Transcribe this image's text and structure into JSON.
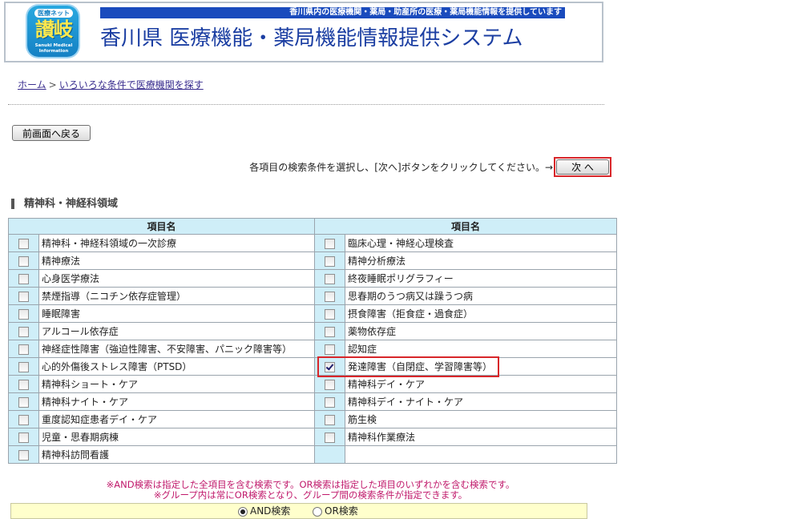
{
  "header": {
    "logo_pill": "医療ネット",
    "logo_name": "讃岐",
    "logo_sub": "Sanuki Medical Information",
    "tagline": "香川県内の医療機関・薬局・助産所の医療・薬局機能情報を提供しています",
    "site_title": "香川県 医療機能・薬局機能情報提供システム"
  },
  "breadcrumb": {
    "home": "ホーム",
    "separator": ">",
    "current": "いろいろな条件で医療機関を探す"
  },
  "buttons": {
    "back": "前画面へ戻る",
    "next": "次 へ"
  },
  "instruction": "各項目の検索条件を選択し、[次へ]ボタンをクリックしてください。→",
  "section": {
    "title": "精神科・神経科領域"
  },
  "table": {
    "header_left": "項目名",
    "header_right": "項目名",
    "left_items": [
      {
        "label": "精神科・神経科領域の一次診療",
        "checked": false
      },
      {
        "label": "精神療法",
        "checked": false
      },
      {
        "label": "心身医学療法",
        "checked": false
      },
      {
        "label": "禁煙指導（ニコチン依存症管理）",
        "checked": false
      },
      {
        "label": "睡眠障害",
        "checked": false
      },
      {
        "label": "アルコール依存症",
        "checked": false
      },
      {
        "label": "神経症性障害（強迫性障害、不安障害、パニック障害等）",
        "checked": false
      },
      {
        "label": "心的外傷後ストレス障害（PTSD）",
        "checked": false
      },
      {
        "label": "精神科ショート・ケア",
        "checked": false
      },
      {
        "label": "精神科ナイト・ケア",
        "checked": false
      },
      {
        "label": "重度認知症患者デイ・ケア",
        "checked": false
      },
      {
        "label": "児童・思春期病棟",
        "checked": false
      },
      {
        "label": "精神科訪問看護",
        "checked": false
      }
    ],
    "right_items": [
      {
        "label": "臨床心理・神経心理検査",
        "checked": false
      },
      {
        "label": "精神分析療法",
        "checked": false
      },
      {
        "label": "終夜睡眠ポリグラフィー",
        "checked": false
      },
      {
        "label": "思春期のうつ病又は躁うつ病",
        "checked": false
      },
      {
        "label": "摂食障害（拒食症・過食症）",
        "checked": false
      },
      {
        "label": "薬物依存症",
        "checked": false
      },
      {
        "label": "認知症",
        "checked": false
      },
      {
        "label": "発達障害（自閉症、学習障害等）",
        "checked": true
      },
      {
        "label": "精神科デイ・ケア",
        "checked": false
      },
      {
        "label": "精神科デイ・ナイト・ケア",
        "checked": false
      },
      {
        "label": "筋生検",
        "checked": false
      },
      {
        "label": "精神科作業療法",
        "checked": false
      }
    ]
  },
  "notes": {
    "line1": "※AND検索は指定した全項目を含む検索です。OR検索は指定した項目のいずれかを含む検索です。",
    "line2": "※グループ内は常にOR検索となり、グループ間の検索条件が指定できます。"
  },
  "search_mode": {
    "and_label": "AND検索",
    "or_label": "OR検索",
    "selected": "AND"
  },
  "colors": {
    "title_blue": "#1b3ea2",
    "tagline_bg": "#1a4bbd",
    "table_header_bg": "#cfeef8",
    "highlight_red": "#d8262a",
    "note_pink": "#c0196b"
  }
}
